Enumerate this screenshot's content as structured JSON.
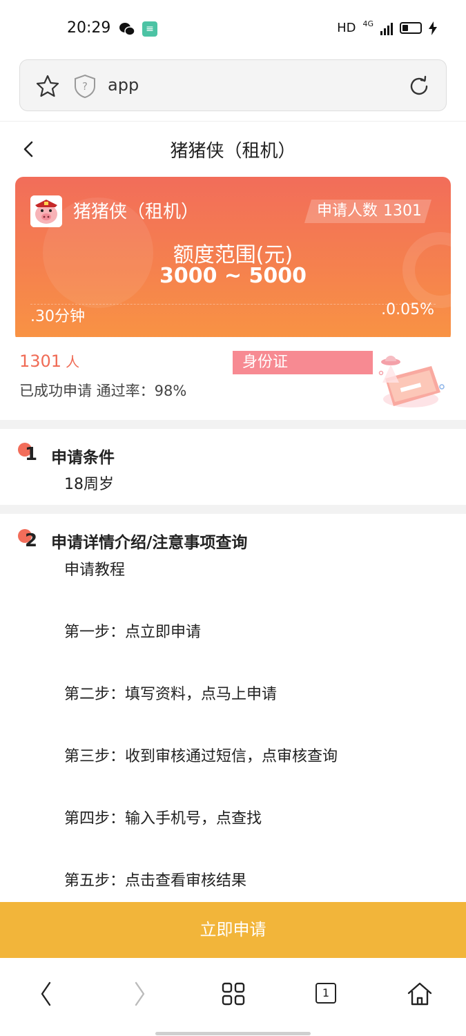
{
  "status_bar": {
    "time": "20:29",
    "hd": "HD",
    "network": "4G"
  },
  "browser": {
    "url": "app"
  },
  "header": {
    "title": "猪猪侠（租机）"
  },
  "hero": {
    "name": "猪猪侠（租机）",
    "applicants_label": "申请人数",
    "applicants_count": "1301",
    "limit_label": "额度范围(元)",
    "limit_range": "3000 ~ 5000",
    "left_info": ".30分钟",
    "right_info": ".0.05%"
  },
  "stats": {
    "count": "1301",
    "unit": "人",
    "description": "已成功申请 通过率：98%",
    "tag": "身份证"
  },
  "section1": {
    "number": "1",
    "title": "申请条件",
    "text": "18周岁"
  },
  "section2": {
    "number": "2",
    "title": "申请详情介绍/注意事项查询",
    "intro": "申请教程",
    "steps": [
      "第一步：点立即申请",
      "第二步：填写资料，点马上申请",
      "第三步：收到审核通过短信，点审核查询",
      "第四步：输入手机号，点查找",
      "第五步：点击查看审核结果"
    ]
  },
  "apply_button": {
    "label": "立即申请"
  },
  "browser_nav": {
    "tab_count": "1"
  },
  "colors": {
    "accent": "#f26d5a",
    "button": "#f2b53a",
    "tag": "#f78a92"
  }
}
